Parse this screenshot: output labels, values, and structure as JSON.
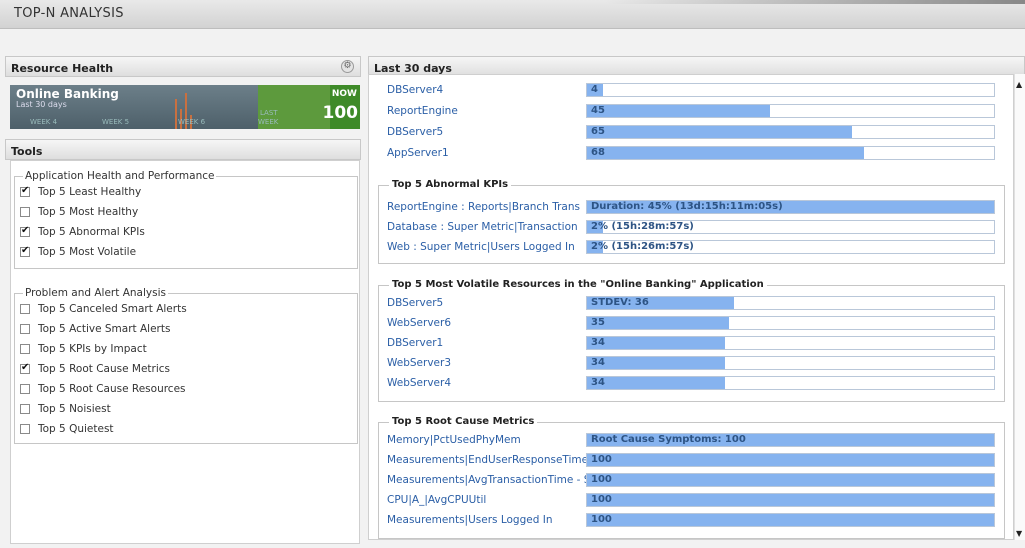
{
  "app_title": "TOP-N ANALYSIS",
  "resource_health": {
    "header": "Resource Health",
    "app_name": "Online Banking",
    "period": "Last 30 days",
    "weeks": [
      "WEEK 4",
      "WEEK 5",
      "WEEK 6",
      "LAST",
      "WEEK"
    ],
    "now_label": "NOW",
    "score": "100",
    "colors": {
      "healthy": "#5d9a3d",
      "history": "#56666e"
    }
  },
  "tools": {
    "header": "Tools",
    "group1": {
      "legend": "Application Health and Performance",
      "items": [
        {
          "label": "Top 5 Least Healthy",
          "checked": true
        },
        {
          "label": "Top 5 Most Healthy",
          "checked": false
        },
        {
          "label": "Top 5 Abnormal KPIs",
          "checked": true
        },
        {
          "label": "Top 5 Most Volatile",
          "checked": true
        }
      ]
    },
    "group2": {
      "legend": "Problem and Alert Analysis",
      "items": [
        {
          "label": "Top 5 Canceled Smart Alerts",
          "checked": false
        },
        {
          "label": "Top 5 Active Smart Alerts",
          "checked": false
        },
        {
          "label": "Top 5 KPIs by Impact",
          "checked": false
        },
        {
          "label": "Top 5 Root Cause Metrics",
          "checked": true
        },
        {
          "label": "Top 5 Root Cause Resources",
          "checked": false
        },
        {
          "label": "Top 5 Noisiest",
          "checked": false
        },
        {
          "label": "Top 5 Quietest",
          "checked": false
        }
      ]
    }
  },
  "main": {
    "header": "Last 30 days",
    "bar_color": "#86b3ef",
    "least_healthy_rows": [
      {
        "name": "DBServer4",
        "value": "4",
        "fraction": 0.04
      },
      {
        "name": "ReportEngine",
        "value": "45",
        "fraction": 0.45
      },
      {
        "name": "DBServer5",
        "value": "65",
        "fraction": 0.65
      },
      {
        "name": "AppServer1",
        "value": "68",
        "fraction": 0.68
      }
    ],
    "abnormal_kpis": {
      "title": "Top 5 Abnormal KPIs",
      "rows": [
        {
          "name": "ReportEngine : Reports|Branch Trans",
          "value": "Duration: 45% (13d:15h:11m:05s)",
          "fraction": 1.0
        },
        {
          "name": "Database : Super Metric|Transaction",
          "value": "2% (15h:28m:57s)",
          "fraction": 0.04
        },
        {
          "name": "Web : Super Metric|Users Logged In",
          "value": "2% (15h:26m:57s)",
          "fraction": 0.04
        }
      ]
    },
    "most_volatile": {
      "title": "Top 5 Most Volatile Resources in the \"Online Banking\" Application",
      "rows": [
        {
          "name": "DBServer5",
          "value": "STDEV: 36",
          "fraction": 0.36
        },
        {
          "name": "WebServer6",
          "value": "35",
          "fraction": 0.35
        },
        {
          "name": "DBServer1",
          "value": "34",
          "fraction": 0.34
        },
        {
          "name": "WebServer3",
          "value": "34",
          "fraction": 0.34
        },
        {
          "name": "WebServer4",
          "value": "34",
          "fraction": 0.34
        }
      ]
    },
    "root_cause": {
      "title": "Top 5 Root Cause Metrics",
      "rows": [
        {
          "name": "Memory|PctUsedPhyMem",
          "value": "Root Cause Symptoms: 100",
          "fraction": 1.0
        },
        {
          "name": "Measurements|EndUserResponseTime",
          "value": "100",
          "fraction": 1.0
        },
        {
          "name": "Measurements|AvgTransactionTime - S",
          "value": "100",
          "fraction": 1.0
        },
        {
          "name": "CPU|A_|AvgCPUUtil",
          "value": "100",
          "fraction": 1.0
        },
        {
          "name": "Measurements|Users Logged In",
          "value": "100",
          "fraction": 1.0
        }
      ]
    }
  }
}
